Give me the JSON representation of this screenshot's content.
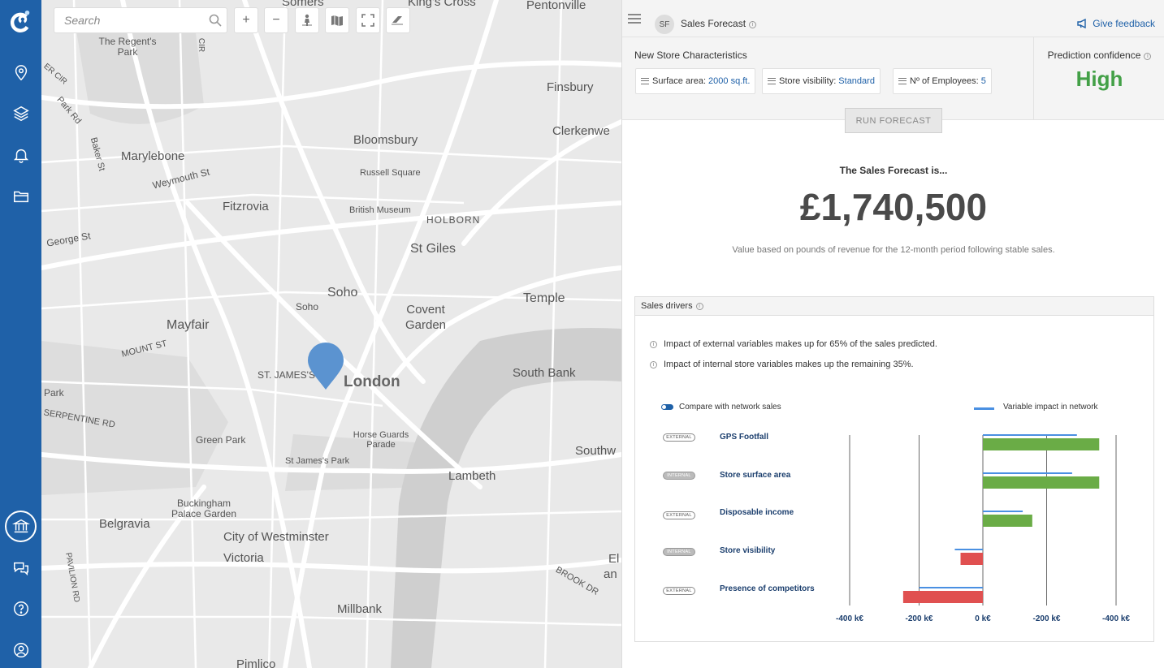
{
  "nav": {
    "items": [
      {
        "name": "logo-icon"
      },
      {
        "name": "location-pin-icon"
      },
      {
        "name": "layers-icon"
      },
      {
        "name": "bell-icon"
      },
      {
        "name": "folder-icon"
      },
      {
        "name": "bank-icon",
        "active": true
      },
      {
        "name": "chat-icon"
      },
      {
        "name": "help-icon"
      },
      {
        "name": "user-icon"
      }
    ],
    "color": "#1f61a8"
  },
  "map": {
    "search_placeholder": "Search",
    "tools": [
      "plus-icon",
      "minus-icon",
      "person-icon",
      "map-icon",
      "fullscreen-icon",
      "eraser-icon"
    ],
    "labels": [
      "Somers",
      "King's Cross",
      "Pentonville",
      "The Regent's Park",
      "Finsbury",
      "Bloomsbury",
      "Clerkenwe",
      "Marylebone",
      "Russell Square",
      "Weymouth St",
      "British Museum",
      "Fitzrovia",
      "HOLBORN",
      "George St",
      "St Giles",
      "Soho",
      "Temple",
      "Mayfair",
      "Covent Garden",
      "MOUNT ST",
      "ST. JAMES'S",
      "London",
      "South Bank",
      "Park",
      "Horse Guards Parade",
      "SERPENTINE RD",
      "Green Park",
      "Southw",
      "St James's Park",
      "Lambeth",
      "Buckingham Palace Garden",
      "Belgravia",
      "City of Westminster",
      "El",
      "an",
      "Victoria",
      "BROOK DR",
      "PAVILION RD",
      "Millbank",
      "Pimlico",
      "Baker St",
      "Park Rd",
      "ER CIR",
      "CIR",
      "Soho"
    ],
    "pin_color": "#5b93d0"
  },
  "panel": {
    "avatar": "SF",
    "title": "Sales Forecast",
    "feedback": "Give feedback",
    "characteristics_title": "New Store Characteristics",
    "chips": [
      {
        "label": "Surface area:",
        "value": "2000 sq.ft."
      },
      {
        "label": "Store visibility:",
        "value": "Standard"
      },
      {
        "label": "Nº of Employees:",
        "value": "5"
      }
    ],
    "confidence_label": "Prediction confidence",
    "confidence_value": "High",
    "confidence_color": "#43a047",
    "run_button": "RUN FORECAST",
    "forecast_label": "The Sales Forecast is...",
    "forecast_value": "£1,740,500",
    "forecast_note": "Value based on pounds of revenue for the 12-month period following stable sales.",
    "drivers": {
      "title": "Sales drivers",
      "impact_external": "Impact of external variables makes up for 65% of the sales predicted.",
      "impact_internal": "Impact of internal store variables makes up the remaining 35%.",
      "toggle_label": "Compare with network sales",
      "toggle_on": true,
      "legend_label": "Variable impact in network"
    }
  },
  "chart_data": {
    "type": "bar",
    "orientation": "horizontal",
    "categories": [
      "GPS Footfall",
      "Store surface area",
      "Disposable income",
      "Store visibility",
      "Presence of competitors"
    ],
    "badges": [
      "EXTERNAL",
      "INTERNAL",
      "EXTERNAL",
      "INTERNAL",
      "EXTERNAL"
    ],
    "series": [
      {
        "values": [
          365,
          365,
          155,
          -70,
          -250
        ],
        "colors": [
          "#6aac46",
          "#6aac46",
          "#6aac46",
          "#e05050",
          "#e05050"
        ]
      },
      {
        "name": "Variable impact in network",
        "values": [
          295,
          280,
          125,
          -88,
          -200
        ],
        "color": "#4a90e2"
      }
    ],
    "x_ticks": [
      -400,
      -200,
      0,
      200,
      400
    ],
    "x_tick_labels": [
      "-400 k€",
      "-200 k€",
      "0 k€",
      "-200 k€",
      "-400 k€"
    ],
    "xlim": [
      -400,
      400
    ]
  }
}
